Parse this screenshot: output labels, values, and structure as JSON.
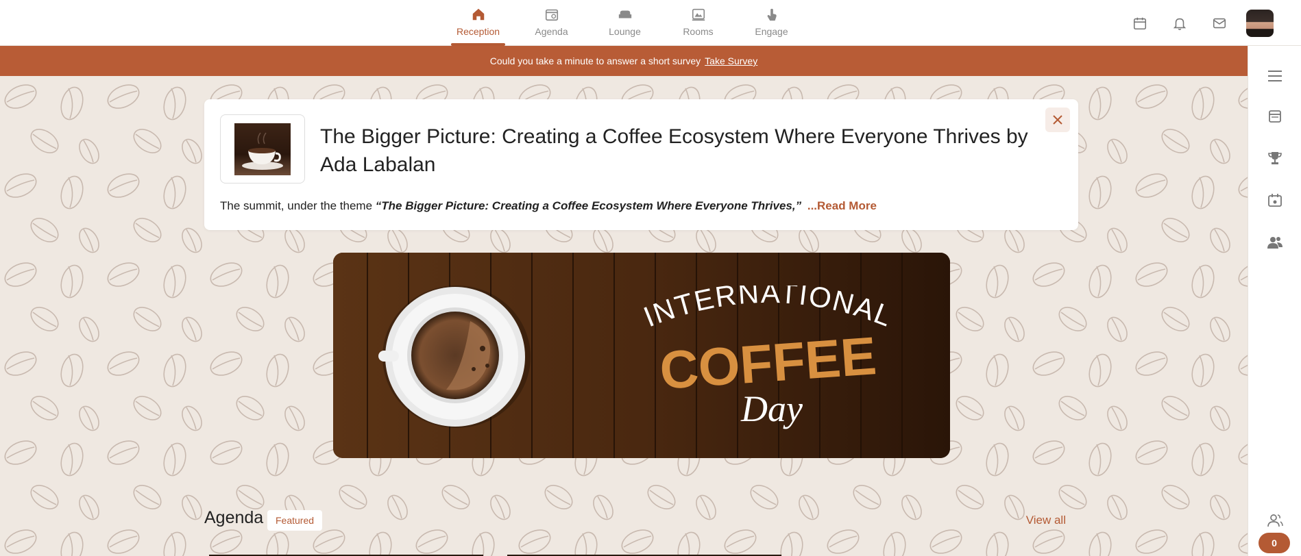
{
  "nav": {
    "items": [
      {
        "label": "Reception",
        "icon": "home-icon",
        "active": true
      },
      {
        "label": "Agenda",
        "icon": "calendar-icon",
        "active": false
      },
      {
        "label": "Lounge",
        "icon": "sofa-icon",
        "active": false
      },
      {
        "label": "Rooms",
        "icon": "rooms-icon",
        "active": false
      },
      {
        "label": "Engage",
        "icon": "hand-pointer-icon",
        "active": false
      }
    ]
  },
  "top_icons": [
    "calendar-icon",
    "bell-icon",
    "mail-icon"
  ],
  "survey": {
    "text": "Could you take a minute to answer a short survey",
    "link": "Take Survey"
  },
  "announcement": {
    "title": "The Bigger Picture: Creating a Coffee Ecosystem Where Everyone Thrives by Ada Labalan",
    "desc_prefix": "The summit, under the theme",
    "desc_quote": "“The Bigger Picture: Creating a Coffee Ecosystem Where Everyone Thrives,”",
    "read_more": "...Read More"
  },
  "hero": {
    "line1": "INTERNATIONAL",
    "line2": "COFFEE",
    "line3": "Day"
  },
  "agenda": {
    "title": "Agenda",
    "badge": "Featured",
    "view_all": "View all"
  },
  "sidebar": {
    "items": [
      "menu-icon",
      "schedule-icon",
      "trophy-icon",
      "event-icon",
      "people-icon",
      "attendees-icon"
    ],
    "count": "0"
  },
  "colors": {
    "accent": "#b45a34",
    "survey_bg": "#b85c36",
    "page_bg": "#efe8e1"
  }
}
